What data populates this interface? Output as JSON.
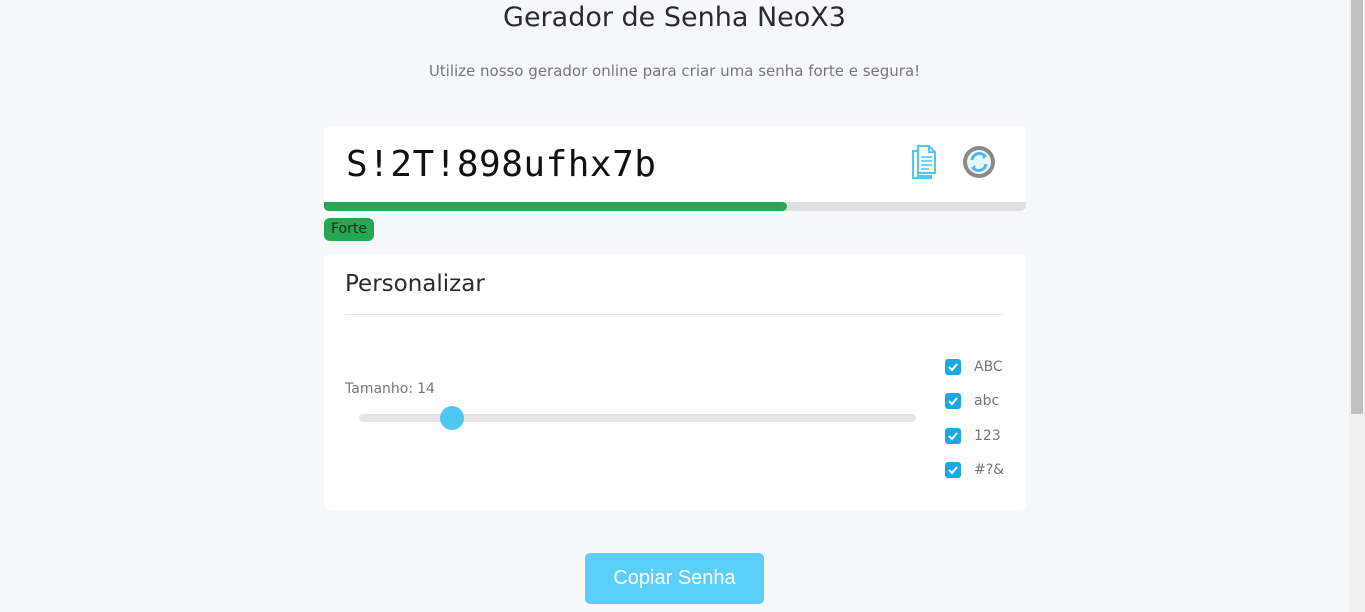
{
  "header": {
    "title": "Gerador de Senha NeoX3",
    "subtitle": "Utilize nosso gerador online para criar uma senha forte e segura!"
  },
  "password": {
    "value": "S!2T!898ufhx7b",
    "copy_icon": "clipboard-icon",
    "refresh_icon": "refresh-icon"
  },
  "strength": {
    "label": "Forte",
    "level": 0.66,
    "color": "#27a654"
  },
  "customize": {
    "title": "Personalizar",
    "length_label": "Tamanho:",
    "length_value": "14",
    "length_slider_fraction": 0.167,
    "options": [
      {
        "label": "ABC",
        "checked": true
      },
      {
        "label": "abc",
        "checked": true
      },
      {
        "label": "123",
        "checked": true
      },
      {
        "label": "#?&",
        "checked": true
      }
    ]
  },
  "actions": {
    "copy_button": "Copiar Senha"
  },
  "colors": {
    "accent": "#5ccff9",
    "checkbox": "#1aa8e6",
    "strong": "#27a654"
  }
}
